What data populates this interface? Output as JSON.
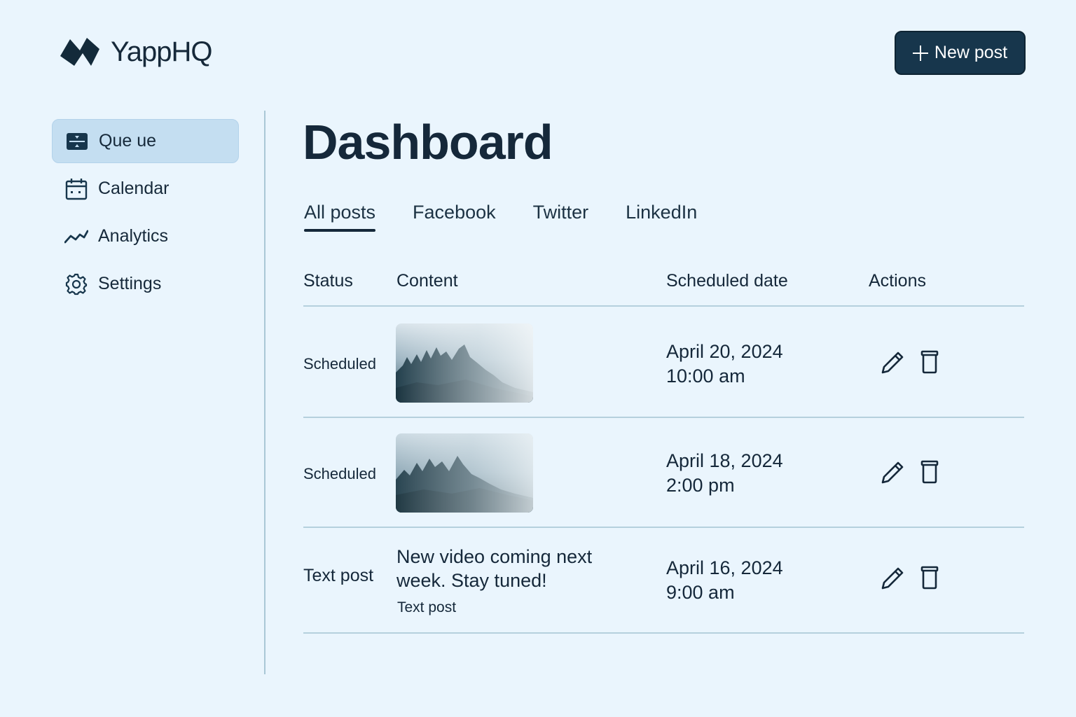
{
  "app": {
    "name": "YappHQ",
    "logo_icon": "yapphq-logo-icon"
  },
  "header": {
    "new_post_label": "New post",
    "new_post_icon": "plus-icon"
  },
  "sidebar": {
    "items": [
      {
        "label": "Que ue",
        "icon": "queue-icon",
        "active": true
      },
      {
        "label": "Calendar",
        "icon": "calendar-icon",
        "active": false
      },
      {
        "label": "Analytics",
        "icon": "analytics-icon",
        "active": false
      },
      {
        "label": "Settings",
        "icon": "gear-icon",
        "active": false
      }
    ]
  },
  "main": {
    "title": "Dashboard",
    "tabs": [
      {
        "label": "All posts",
        "active": true
      },
      {
        "label": "Facebook",
        "active": false
      },
      {
        "label": "Twitter",
        "active": false
      },
      {
        "label": "LinkedIn",
        "active": false
      }
    ],
    "table": {
      "columns": [
        "Status",
        "Content",
        "Scheduled date",
        "Actions"
      ],
      "rows": [
        {
          "status": "Scheduled",
          "content_type": "image",
          "date": "April 20, 2024",
          "time": "10:00 am"
        },
        {
          "status": "Scheduled",
          "content_type": "image",
          "date": "April 18, 2024",
          "time": "2:00 pm"
        },
        {
          "status": "Text post",
          "content_type": "text",
          "text_line1": "New video coming next",
          "text_line2": "week. Stay tuned!",
          "subtext": "Text post",
          "date": "April 16, 2024",
          "time": "9:00 am"
        }
      ]
    }
  },
  "colors": {
    "background": "#eaf5fd",
    "primary": "#17364c",
    "active_nav": "#c4def1",
    "text": "#15283a",
    "rule": "#b5d0dd"
  }
}
